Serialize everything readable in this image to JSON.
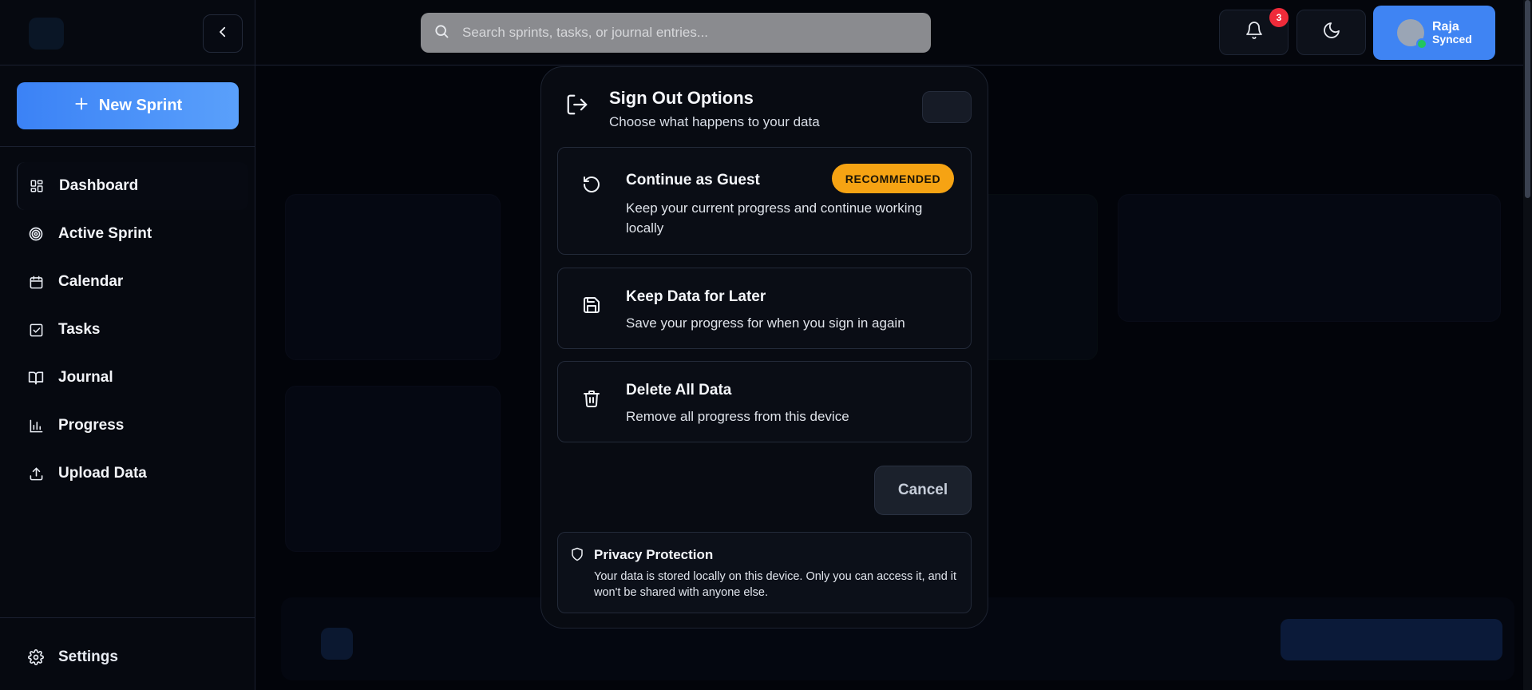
{
  "sidebar": {
    "new_sprint_label": "New Sprint",
    "items": [
      {
        "label": "Dashboard",
        "icon": "dashboard-icon"
      },
      {
        "label": "Active Sprint",
        "icon": "target-icon"
      },
      {
        "label": "Calendar",
        "icon": "calendar-icon"
      },
      {
        "label": "Tasks",
        "icon": "checkbox-icon"
      },
      {
        "label": "Journal",
        "icon": "book-icon"
      },
      {
        "label": "Progress",
        "icon": "bar-chart-icon"
      },
      {
        "label": "Upload Data",
        "icon": "upload-icon"
      }
    ],
    "settings_label": "Settings"
  },
  "header": {
    "search_placeholder": "Search sprints, tasks, or journal entries...",
    "notification_count": "3",
    "user": {
      "name": "Raja",
      "status": "Synced"
    }
  },
  "modal": {
    "title": "Sign Out Options",
    "subtitle": "Choose what happens to your data",
    "options": [
      {
        "title": "Continue as Guest",
        "badge": "RECOMMENDED",
        "description": "Keep your current progress and continue working locally",
        "icon": "refresh-icon"
      },
      {
        "title": "Keep Data for Later",
        "description": "Save your progress for when you sign in again",
        "icon": "save-icon"
      },
      {
        "title": "Delete All Data",
        "description": "Remove all progress from this device",
        "icon": "trash-icon"
      }
    ],
    "cancel_label": "Cancel",
    "privacy": {
      "title": "Privacy Protection",
      "text": "Your data is stored locally on this device. Only you can access it, and it won't be shared with anyone else."
    }
  },
  "colors": {
    "accent": "#3f84f3",
    "badge": "#f6a313",
    "notification": "#ef2b3a",
    "online": "#22c55e"
  }
}
